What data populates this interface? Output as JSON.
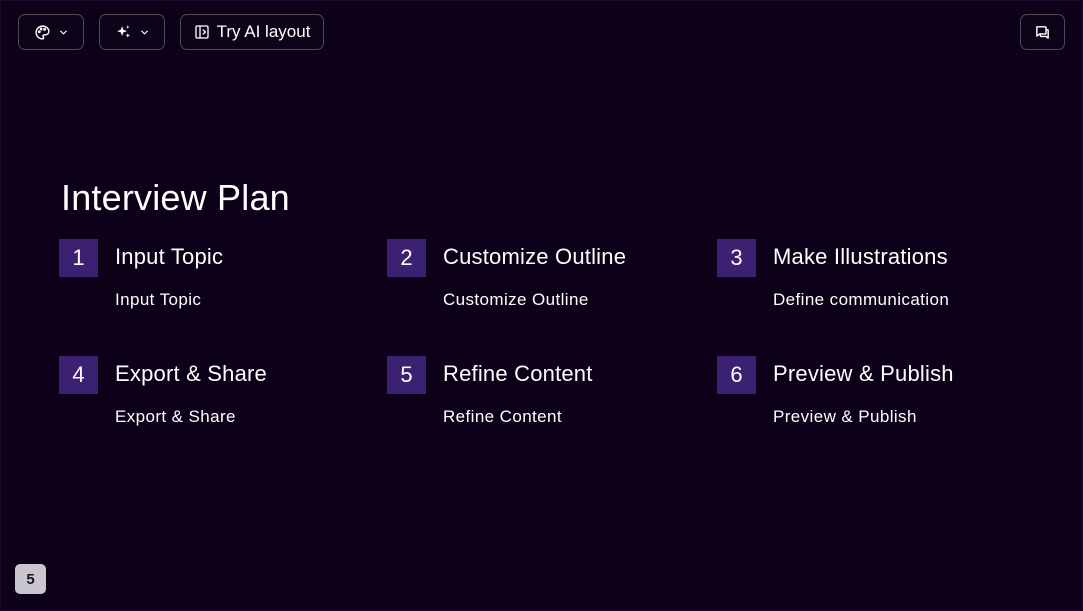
{
  "toolbar": {
    "theme_button": {
      "icon": "palette-icon",
      "chevron": "chevron-down-icon"
    },
    "ai_button": {
      "icon": "sparkles-icon",
      "chevron": "chevron-down-icon"
    },
    "layout_button": {
      "icon": "layout-icon",
      "label": "Try AI layout"
    },
    "comment_button": {
      "icon": "comment-icon"
    }
  },
  "slide": {
    "title": "Interview Plan",
    "accent_color": "#3c2172",
    "background_color": "#0c0118",
    "steps": [
      {
        "number": "1",
        "title": "Input Topic",
        "description": "Input Topic"
      },
      {
        "number": "2",
        "title": "Customize Outline",
        "description": "Customize Outline"
      },
      {
        "number": "3",
        "title": "Make Illustrations",
        "description": "Define communication"
      },
      {
        "number": "4",
        "title": "Export & Share",
        "description": "Export & Share"
      },
      {
        "number": "5",
        "title": "Refine Content",
        "description": "Refine Content"
      },
      {
        "number": "6",
        "title": "Preview & Publish",
        "description": "Preview & Publish"
      }
    ]
  },
  "page_indicator": "5"
}
